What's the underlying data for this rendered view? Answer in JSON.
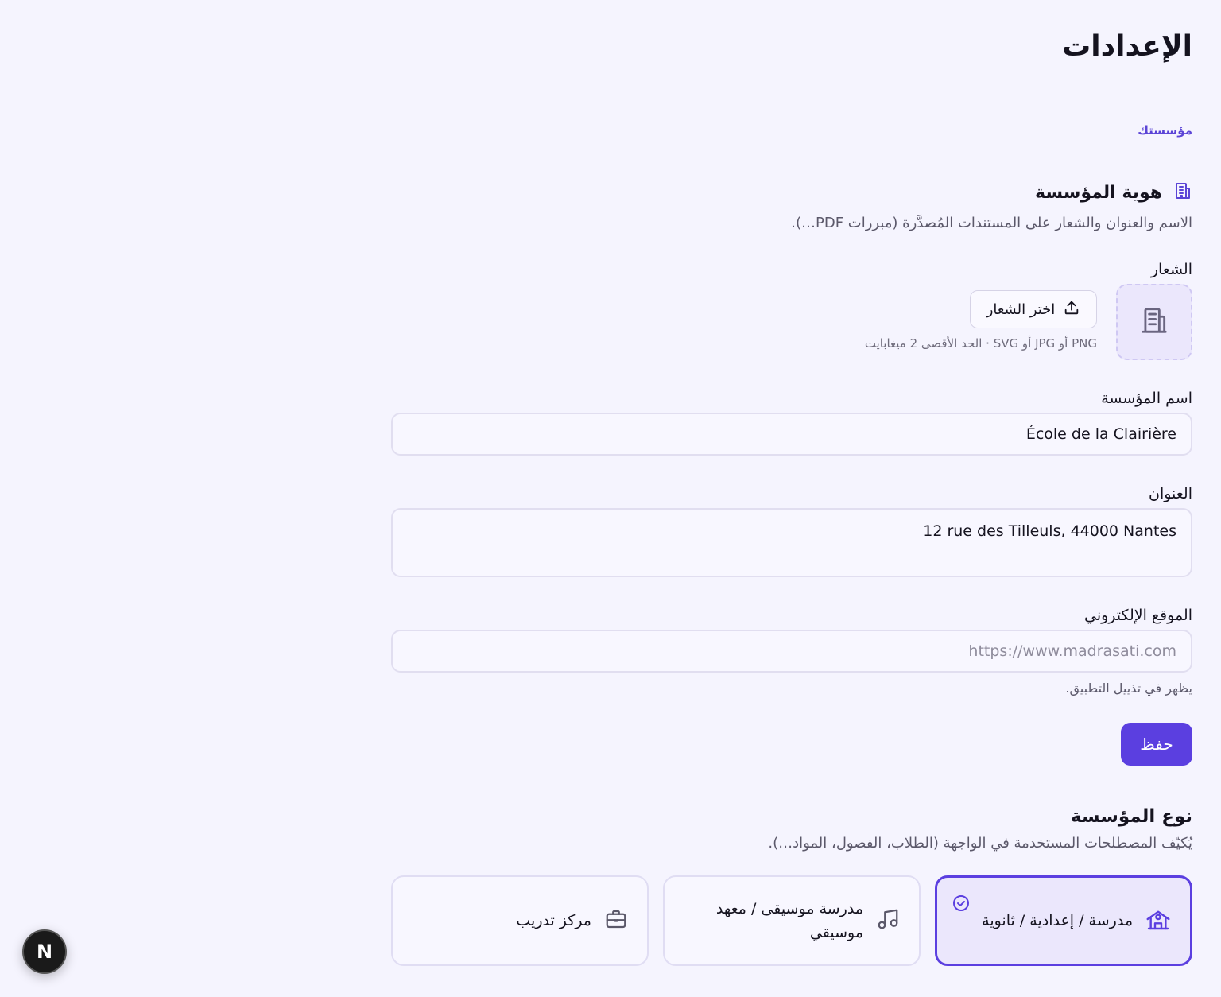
{
  "page": {
    "title": "الإعدادات"
  },
  "tabs": [
    {
      "label": "مؤسستك",
      "active": true
    }
  ],
  "identity": {
    "title": "هوية المؤسسة",
    "description": "الاسم والعنوان والشعار على المستندات المُصدَّرة (مبررات PDF…).",
    "logo": {
      "label": "الشعار",
      "button_label": "اختر الشعار",
      "hint": "PNG أو JPG أو SVG · الحد الأقصى 2 ميغابايت"
    },
    "name": {
      "label": "اسم المؤسسة",
      "value": "École de la Clairière"
    },
    "address": {
      "label": "العنوان",
      "value": "12 rue des Tilleuls, 44000 Nantes"
    },
    "website": {
      "label": "الموقع الإلكتروني",
      "value": "",
      "placeholder": "https://www.madrasati.com",
      "hint": "يظهر في تذييل التطبيق."
    },
    "save_label": "حفظ"
  },
  "org_type": {
    "title": "نوع المؤسسة",
    "description": "يُكيّف المصطلحات المستخدمة في الواجهة (الطلاب، الفصول، المواد…).",
    "options": [
      {
        "label": "مدرسة / إعدادية / ثانوية",
        "icon": "school-icon",
        "selected": true
      },
      {
        "label": "مدرسة موسيقى / معهد موسيقي",
        "icon": "music-note-icon",
        "selected": false
      },
      {
        "label": "مركز تدريب",
        "icon": "briefcase-icon",
        "selected": false
      }
    ]
  },
  "badge": {
    "letter": "N"
  },
  "colors": {
    "accent": "#5b3fe0",
    "background": "#f5f4fe",
    "accent_soft": "#ebe7fc"
  }
}
